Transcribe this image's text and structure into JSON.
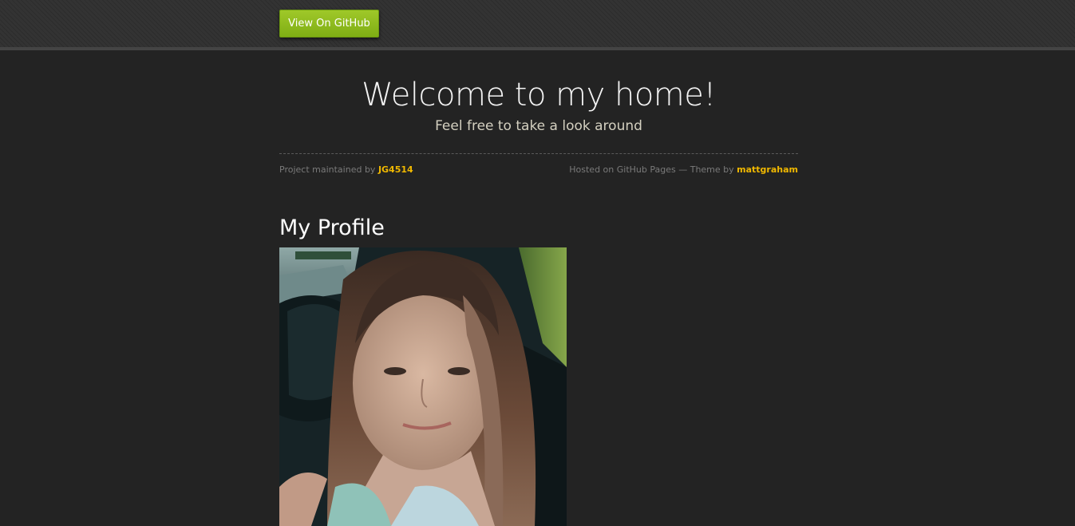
{
  "topbar": {
    "github_button_label": "View On GitHub"
  },
  "header": {
    "title": "Welcome to my home!",
    "subtitle": "Feel free to take a look around"
  },
  "credits": {
    "maintained_prefix": "Project maintained by",
    "maintainer": "JG4514",
    "hosted_prefix": "Hosted on GitHub Pages — Theme by",
    "theme_author": "mattgraham"
  },
  "main": {
    "section_title": "My Profile",
    "profile_photo": "portrait photo of a woman with long reddish-brown hair in a car"
  },
  "colors": {
    "background": "#232323",
    "topbar": "#333333",
    "button_green": "#8cbb1e",
    "link_gold": "#f0b800"
  }
}
